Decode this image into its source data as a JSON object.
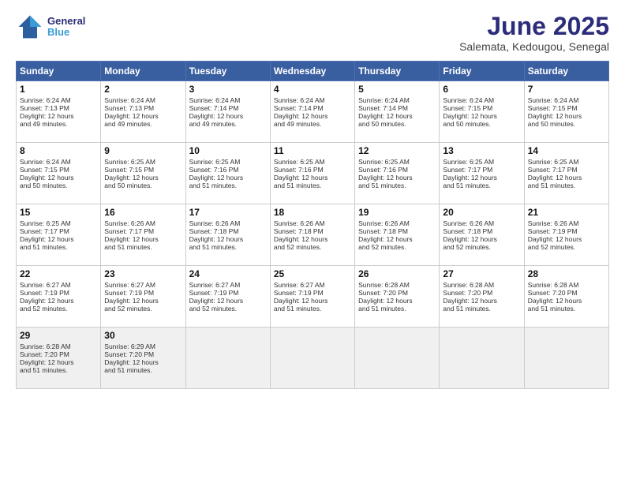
{
  "logo": {
    "line1": "General",
    "line2": "Blue"
  },
  "title": "June 2025",
  "subtitle": "Salemata, Kedougou, Senegal",
  "days_of_week": [
    "Sunday",
    "Monday",
    "Tuesday",
    "Wednesday",
    "Thursday",
    "Friday",
    "Saturday"
  ],
  "weeks": [
    [
      {
        "day": "1",
        "info": "Sunrise: 6:24 AM\nSunset: 7:13 PM\nDaylight: 12 hours\nand 49 minutes."
      },
      {
        "day": "2",
        "info": "Sunrise: 6:24 AM\nSunset: 7:13 PM\nDaylight: 12 hours\nand 49 minutes."
      },
      {
        "day": "3",
        "info": "Sunrise: 6:24 AM\nSunset: 7:14 PM\nDaylight: 12 hours\nand 49 minutes."
      },
      {
        "day": "4",
        "info": "Sunrise: 6:24 AM\nSunset: 7:14 PM\nDaylight: 12 hours\nand 49 minutes."
      },
      {
        "day": "5",
        "info": "Sunrise: 6:24 AM\nSunset: 7:14 PM\nDaylight: 12 hours\nand 50 minutes."
      },
      {
        "day": "6",
        "info": "Sunrise: 6:24 AM\nSunset: 7:15 PM\nDaylight: 12 hours\nand 50 minutes."
      },
      {
        "day": "7",
        "info": "Sunrise: 6:24 AM\nSunset: 7:15 PM\nDaylight: 12 hours\nand 50 minutes."
      }
    ],
    [
      {
        "day": "8",
        "info": "Sunrise: 6:24 AM\nSunset: 7:15 PM\nDaylight: 12 hours\nand 50 minutes."
      },
      {
        "day": "9",
        "info": "Sunrise: 6:25 AM\nSunset: 7:15 PM\nDaylight: 12 hours\nand 50 minutes."
      },
      {
        "day": "10",
        "info": "Sunrise: 6:25 AM\nSunset: 7:16 PM\nDaylight: 12 hours\nand 51 minutes."
      },
      {
        "day": "11",
        "info": "Sunrise: 6:25 AM\nSunset: 7:16 PM\nDaylight: 12 hours\nand 51 minutes."
      },
      {
        "day": "12",
        "info": "Sunrise: 6:25 AM\nSunset: 7:16 PM\nDaylight: 12 hours\nand 51 minutes."
      },
      {
        "day": "13",
        "info": "Sunrise: 6:25 AM\nSunset: 7:17 PM\nDaylight: 12 hours\nand 51 minutes."
      },
      {
        "day": "14",
        "info": "Sunrise: 6:25 AM\nSunset: 7:17 PM\nDaylight: 12 hours\nand 51 minutes."
      }
    ],
    [
      {
        "day": "15",
        "info": "Sunrise: 6:25 AM\nSunset: 7:17 PM\nDaylight: 12 hours\nand 51 minutes."
      },
      {
        "day": "16",
        "info": "Sunrise: 6:26 AM\nSunset: 7:17 PM\nDaylight: 12 hours\nand 51 minutes."
      },
      {
        "day": "17",
        "info": "Sunrise: 6:26 AM\nSunset: 7:18 PM\nDaylight: 12 hours\nand 51 minutes."
      },
      {
        "day": "18",
        "info": "Sunrise: 6:26 AM\nSunset: 7:18 PM\nDaylight: 12 hours\nand 52 minutes."
      },
      {
        "day": "19",
        "info": "Sunrise: 6:26 AM\nSunset: 7:18 PM\nDaylight: 12 hours\nand 52 minutes."
      },
      {
        "day": "20",
        "info": "Sunrise: 6:26 AM\nSunset: 7:18 PM\nDaylight: 12 hours\nand 52 minutes."
      },
      {
        "day": "21",
        "info": "Sunrise: 6:26 AM\nSunset: 7:19 PM\nDaylight: 12 hours\nand 52 minutes."
      }
    ],
    [
      {
        "day": "22",
        "info": "Sunrise: 6:27 AM\nSunset: 7:19 PM\nDaylight: 12 hours\nand 52 minutes."
      },
      {
        "day": "23",
        "info": "Sunrise: 6:27 AM\nSunset: 7:19 PM\nDaylight: 12 hours\nand 52 minutes."
      },
      {
        "day": "24",
        "info": "Sunrise: 6:27 AM\nSunset: 7:19 PM\nDaylight: 12 hours\nand 52 minutes."
      },
      {
        "day": "25",
        "info": "Sunrise: 6:27 AM\nSunset: 7:19 PM\nDaylight: 12 hours\nand 51 minutes."
      },
      {
        "day": "26",
        "info": "Sunrise: 6:28 AM\nSunset: 7:20 PM\nDaylight: 12 hours\nand 51 minutes."
      },
      {
        "day": "27",
        "info": "Sunrise: 6:28 AM\nSunset: 7:20 PM\nDaylight: 12 hours\nand 51 minutes."
      },
      {
        "day": "28",
        "info": "Sunrise: 6:28 AM\nSunset: 7:20 PM\nDaylight: 12 hours\nand 51 minutes."
      }
    ],
    [
      {
        "day": "29",
        "info": "Sunrise: 6:28 AM\nSunset: 7:20 PM\nDaylight: 12 hours\nand 51 minutes."
      },
      {
        "day": "30",
        "info": "Sunrise: 6:29 AM\nSunset: 7:20 PM\nDaylight: 12 hours\nand 51 minutes."
      },
      {
        "day": "",
        "info": ""
      },
      {
        "day": "",
        "info": ""
      },
      {
        "day": "",
        "info": ""
      },
      {
        "day": "",
        "info": ""
      },
      {
        "day": "",
        "info": ""
      }
    ]
  ]
}
